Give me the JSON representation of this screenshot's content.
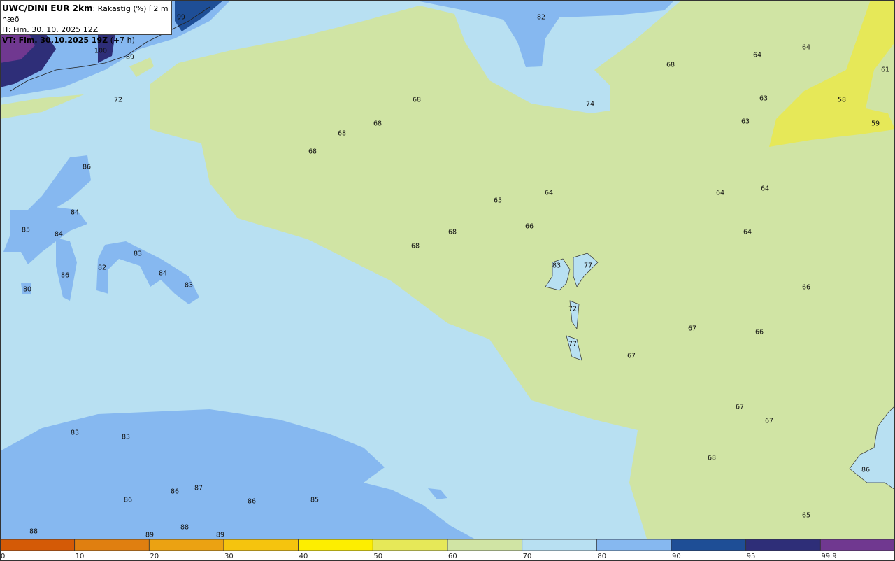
{
  "header": {
    "model": "UWC/DINI EUR 2km",
    "field": ": Rakastig (%) í 2 m hæð",
    "it_line": "IT: Fim. 30. 10. 2025 12Z",
    "vt_bold": "VT: Fim. 30.10.2025 19Z",
    "vt_offset": " (+7 h)"
  },
  "colors": {
    "0-10": "#d45a06",
    "10-20": "#e07f10",
    "20-30": "#eba212",
    "30-40": "#f5c40e",
    "40-50": "#fdee00",
    "50-60": "#e6e858",
    "60-70": "#d0e4a4",
    "70-80": "#b8e0f2",
    "80-90": "#86b8f0",
    "90-95": "#1e4e96",
    "95-99.9": "#2e2e78",
    "99.9-100": "#703890"
  },
  "colorbar": {
    "ticks": [
      "0",
      "10",
      "20",
      "30",
      "40",
      "50",
      "60",
      "70",
      "80",
      "90",
      "95",
      "99.9"
    ]
  },
  "labels": [
    "99",
    "100",
    "89",
    "82",
    "72",
    "68",
    "74",
    "68",
    "64",
    "64",
    "61",
    "63",
    "58",
    "63",
    "59",
    "68",
    "68",
    "68",
    "86",
    "64",
    "65",
    "64",
    "64",
    "84",
    "85",
    "84",
    "66",
    "68",
    "64",
    "68",
    "83",
    "83",
    "77",
    "82",
    "86",
    "84",
    "83",
    "80",
    "66",
    "72",
    "67",
    "66",
    "77",
    "67",
    "67",
    "67",
    "83",
    "83",
    "68",
    "86",
    "87",
    "86",
    "86",
    "86",
    "85",
    "65",
    "88",
    "88",
    "89",
    "89"
  ]
}
